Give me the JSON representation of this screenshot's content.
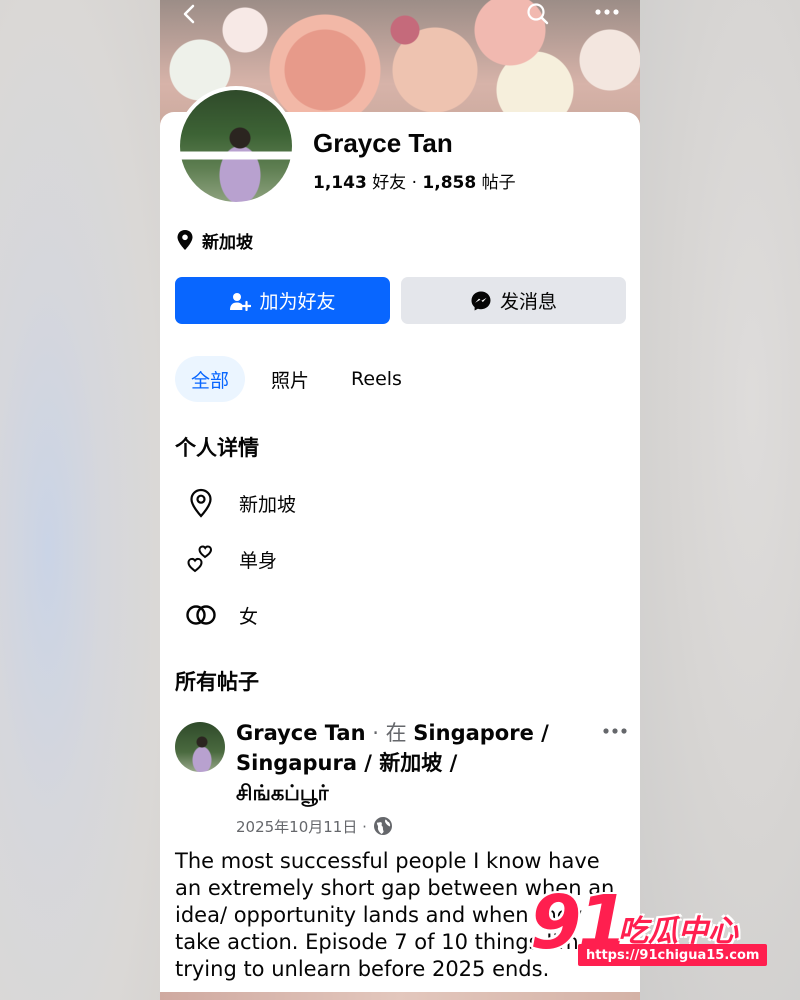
{
  "topbar": {
    "back": "back-icon",
    "search": "search-icon",
    "more": "more-icon"
  },
  "profile": {
    "name": "Grayce Tan",
    "friends_count": "1,143",
    "friends_label": "好友",
    "separator": "·",
    "posts_count": "1,858",
    "posts_label": "帖子",
    "location": "新加坡"
  },
  "actions": {
    "add_friend": "加为好友",
    "message": "发消息"
  },
  "tabs": [
    {
      "label": "全部",
      "active": true
    },
    {
      "label": "照片",
      "active": false
    },
    {
      "label": "Reels",
      "active": false
    }
  ],
  "details": {
    "title": "个人详情",
    "items": [
      {
        "icon": "location-pin-icon",
        "text": "新加坡"
      },
      {
        "icon": "hearts-icon",
        "text": "单身"
      },
      {
        "icon": "gender-rings-icon",
        "text": "女"
      }
    ]
  },
  "posts_section": {
    "title": "所有帖子"
  },
  "post": {
    "author": "Grayce Tan",
    "at_prefix": "· 在",
    "place_line1": "Singapore /",
    "place_line2": "Singapura / 新加坡 /",
    "place_line3": "சிங்கப்பூர்",
    "date": "2025年10月11日 ·",
    "privacy_icon": "globe-icon",
    "text": "The most successful people I know have an extremely short gap between when an idea/ opportunity lands and when they take action. Episode 7 of 10 things I'm trying to unlearn before 2025 ends."
  },
  "watermark": {
    "number": "91",
    "text": "吃瓜中心",
    "url": "https://91chigua15.com"
  },
  "colors": {
    "primary": "#0866ff",
    "secondary_button": "#e4e6eb",
    "active_tab_bg": "#ebf5ff",
    "muted_text": "#65676b",
    "watermark": "#ff1f4f"
  }
}
